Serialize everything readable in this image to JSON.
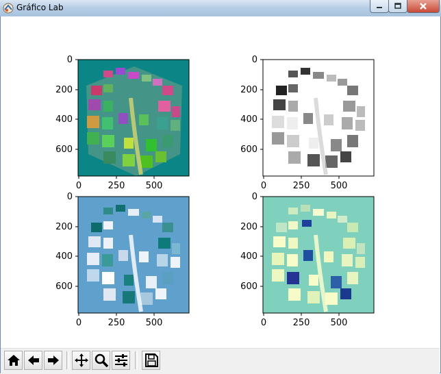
{
  "window": {
    "title": "Gráfico Lab",
    "accent": "#b9cfe6",
    "close_color": "#c94a36"
  },
  "figure": {
    "subplots": [
      {
        "id": "top-left",
        "colormap": "default (RGB)",
        "background": "#0b8585"
      },
      {
        "id": "top-right",
        "colormap": "gray",
        "background": "#ffffff"
      },
      {
        "id": "bottom-left",
        "colormap": "PuBuGn-like",
        "background": "#5fa0cc"
      },
      {
        "id": "bottom-right",
        "colormap": "YlGnBu-like",
        "background": "#7fd0bd"
      }
    ]
  },
  "chart_data": [
    {
      "type": "heatmap",
      "title": "",
      "xlabel": "",
      "ylabel": "",
      "xlim": [
        0,
        700
      ],
      "ylim": [
        760,
        0
      ],
      "xticks": [
        "0",
        "250",
        "500"
      ],
      "yticks": [
        "0",
        "200",
        "400",
        "600"
      ],
      "colormap": "RGB image"
    },
    {
      "type": "heatmap",
      "title": "",
      "xlabel": "",
      "ylabel": "",
      "xlim": [
        0,
        700
      ],
      "ylim": [
        760,
        0
      ],
      "xticks": [
        "0",
        "250",
        "500"
      ],
      "yticks": [
        "0",
        "200",
        "400",
        "600"
      ],
      "colormap": "gray"
    },
    {
      "type": "heatmap",
      "title": "",
      "xlabel": "",
      "ylabel": "",
      "xlim": [
        0,
        700
      ],
      "ylim": [
        760,
        0
      ],
      "xticks": [
        "0",
        "250",
        "500"
      ],
      "yticks": [
        "0",
        "200",
        "400",
        "600"
      ],
      "colormap": "PuBuGn"
    },
    {
      "type": "heatmap",
      "title": "",
      "xlabel": "",
      "ylabel": "",
      "xlim": [
        0,
        700
      ],
      "ylim": [
        760,
        0
      ],
      "xticks": [
        "0",
        "250",
        "500"
      ],
      "yticks": [
        "0",
        "200",
        "400",
        "600"
      ],
      "colormap": "YlGnBu"
    }
  ],
  "toolbar": {
    "buttons": [
      {
        "name": "home-icon"
      },
      {
        "name": "back-arrow-icon"
      },
      {
        "name": "forward-arrow-icon"
      },
      {
        "name": "pan-icon"
      },
      {
        "name": "zoom-icon"
      },
      {
        "name": "configure-subplots-icon"
      },
      {
        "name": "save-icon"
      }
    ]
  }
}
